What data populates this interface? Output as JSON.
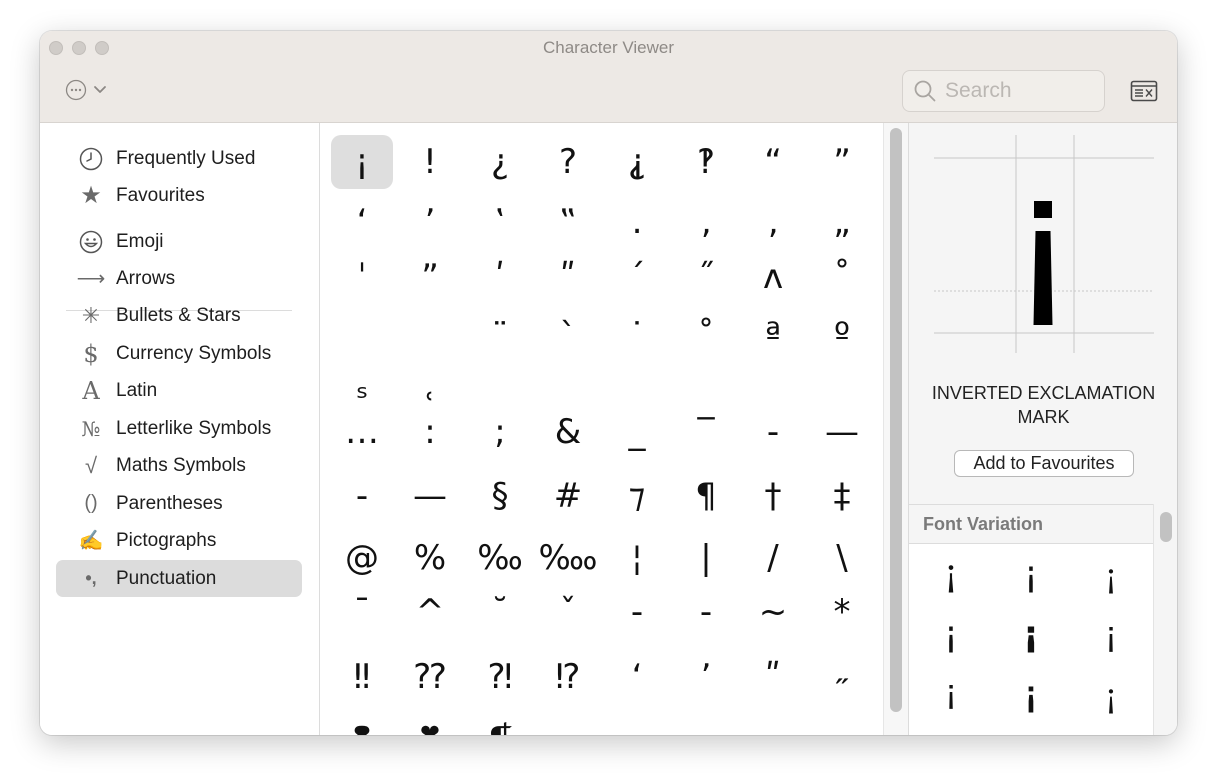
{
  "window": {
    "title": "Character Viewer"
  },
  "toolbar": {
    "more_icon": "ellipsis-circle-icon",
    "chevron_icon": "chevron-down-icon",
    "search_placeholder": "Search",
    "palette_icon": "keyboard-viewer-icon"
  },
  "sidebar": {
    "items": [
      {
        "label": "Frequently Used",
        "icon": "clock-icon",
        "glyph": ""
      },
      {
        "label": "Favourites",
        "icon": "star-icon",
        "glyph": "★"
      },
      {
        "label": "Emoji",
        "icon": "smiley-icon",
        "glyph": ""
      },
      {
        "label": "Arrows",
        "icon": "arrow-icon",
        "glyph": "⟶"
      },
      {
        "label": "Bullets & Stars",
        "icon": "asterisk-icon",
        "glyph": "✳"
      },
      {
        "label": "Currency Symbols",
        "icon": "dollar-icon",
        "glyph": "$"
      },
      {
        "label": "Latin",
        "icon": "latin-a-icon",
        "glyph": "A"
      },
      {
        "label": "Letterlike Symbols",
        "icon": "numero-icon",
        "glyph": "№"
      },
      {
        "label": "Maths Symbols",
        "icon": "square-root-icon",
        "glyph": "√"
      },
      {
        "label": "Parentheses",
        "icon": "parentheses-icon",
        "glyph": "()"
      },
      {
        "label": "Pictographs",
        "icon": "writing-hand-icon",
        "glyph": "✍"
      },
      {
        "label": "Punctuation",
        "icon": "punctuation-icon",
        "glyph": "•,",
        "selected": true
      }
    ]
  },
  "grid": {
    "characters": [
      "¡",
      "!",
      "¿",
      "?",
      "⸘",
      "‽",
      "“",
      "”",
      "‘",
      "’",
      "‛",
      "‟",
      "․",
      "‚",
      "‚",
      "„",
      "ˈ",
      "ˮ",
      "ʹ",
      "ʺ",
      "ˊ",
      "˝",
      "ʌ",
      "˚",
      "",
      "",
      "¨",
      "`",
      "˙",
      "˚",
      "ª",
      "º",
      "ˢ",
      "˓",
      "",
      "",
      "",
      "",
      "",
      "",
      "…",
      ":",
      ";",
      "&",
      "_",
      "‾",
      "-",
      "—",
      "-",
      "—",
      "§",
      "#",
      "⁊",
      "¶",
      "†",
      "‡",
      "@",
      "%",
      "‰",
      "‱",
      "¦",
      "|",
      "/",
      "\\",
      "¯",
      "^",
      "˘",
      "ˇ",
      "-",
      "-",
      "~",
      "*",
      "‼",
      "⁇",
      "⁈",
      "⁉",
      "ʻ",
      "ʼ",
      "ʺ",
      "˶",
      "❢",
      "❣",
      "❡",
      "",
      "",
      "",
      "",
      ""
    ],
    "selected_index": 0
  },
  "detail": {
    "preview_char": "¡",
    "name": "INVERTED EXCLAMATION MARK",
    "add_favourites_label": "Add to Favourites",
    "font_variation_label": "Font Variation",
    "variations": [
      "¡",
      "¡",
      "¡",
      "¡",
      "¡",
      "¡",
      "¡",
      "¡",
      "¡"
    ]
  }
}
